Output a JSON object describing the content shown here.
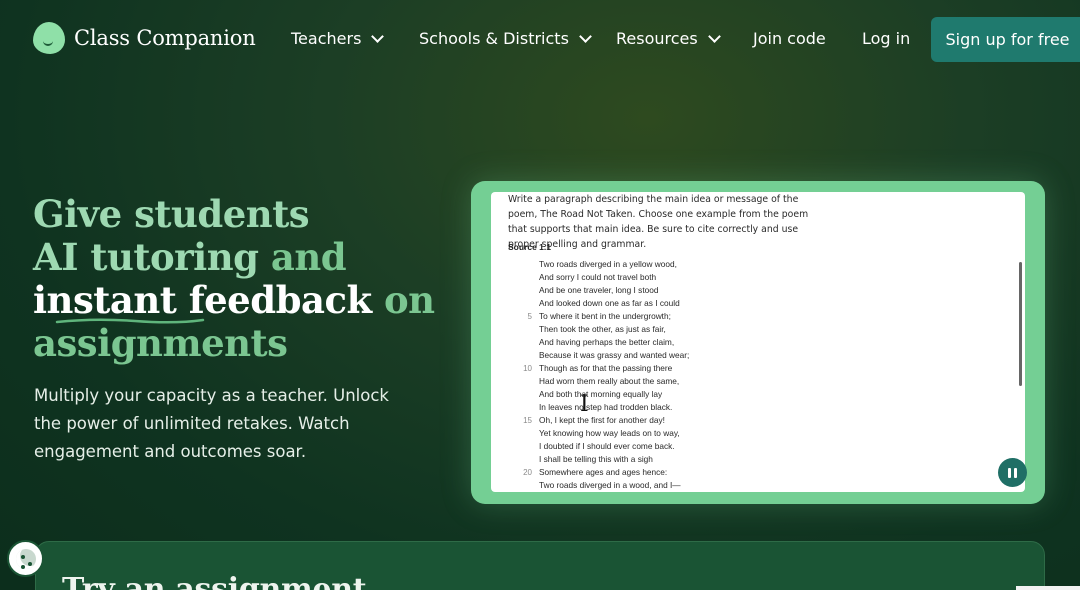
{
  "brand": {
    "name": "Class Companion"
  },
  "nav": {
    "items": [
      {
        "label": "Teachers",
        "has_dropdown": true
      },
      {
        "label": "Schools & Districts",
        "has_dropdown": true
      },
      {
        "label": "Resources",
        "has_dropdown": true
      },
      {
        "label": "Join code",
        "has_dropdown": false
      },
      {
        "label": "Log in",
        "has_dropdown": false
      }
    ],
    "cta": "Sign up for free"
  },
  "hero": {
    "headline": {
      "line1": "Give students",
      "line2a": "AI tutoring",
      "line2b": "and",
      "line3a": "instant feedback",
      "line3b": "on",
      "line4": "assignments"
    },
    "subtitle": "Multiply your capacity as a teacher. Unlock the power of unlimited retakes. Watch engagement and outcomes soar."
  },
  "demo": {
    "prompt": "Write a paragraph describing the main idea or message of the poem, The Road Not Taken. Choose one example from the poem that supports that main idea. Be sure to cite correctly and use proper spelling and grammar.",
    "source_label": "Source 1.1",
    "poem_lines": [
      {
        "num": "",
        "text": "Two roads diverged in a yellow wood,"
      },
      {
        "num": "",
        "text": "And sorry I could not travel both"
      },
      {
        "num": "",
        "text": "And be one traveler, long I stood"
      },
      {
        "num": "",
        "text": "And looked down one as far as I could"
      },
      {
        "num": "5",
        "text": "To where it bent in the undergrowth;"
      },
      {
        "num": "",
        "text": "Then took the other, as just as fair,"
      },
      {
        "num": "",
        "text": "And having perhaps the better claim,"
      },
      {
        "num": "",
        "text": "Because it was grassy and wanted wear;"
      },
      {
        "num": "10",
        "text": "Though as for that the passing there"
      },
      {
        "num": "",
        "text": "Had worn them really about the same,"
      },
      {
        "num": "",
        "text": "And both that morning equally lay"
      },
      {
        "num": "",
        "text": "In leaves no step had trodden black."
      },
      {
        "num": "15",
        "text": "Oh, I kept the first for another day!"
      },
      {
        "num": "",
        "text": "Yet knowing how way leads on to way,"
      },
      {
        "num": "",
        "text": "I doubted if I should ever come back."
      },
      {
        "num": "",
        "text": "I shall be telling this with a sigh"
      },
      {
        "num": "20",
        "text": "Somewhere ages and ages hence:"
      },
      {
        "num": "",
        "text": "Two roads diverged in a wood, and I—"
      }
    ],
    "pause_icon": "pause-icon"
  },
  "try_section": {
    "title": "Try an assignment"
  },
  "colors": {
    "background": "#0f3320",
    "accent_green": "#74cf94",
    "cta_teal": "#1f7a6e",
    "headline_soft": "#9ed9b2"
  }
}
